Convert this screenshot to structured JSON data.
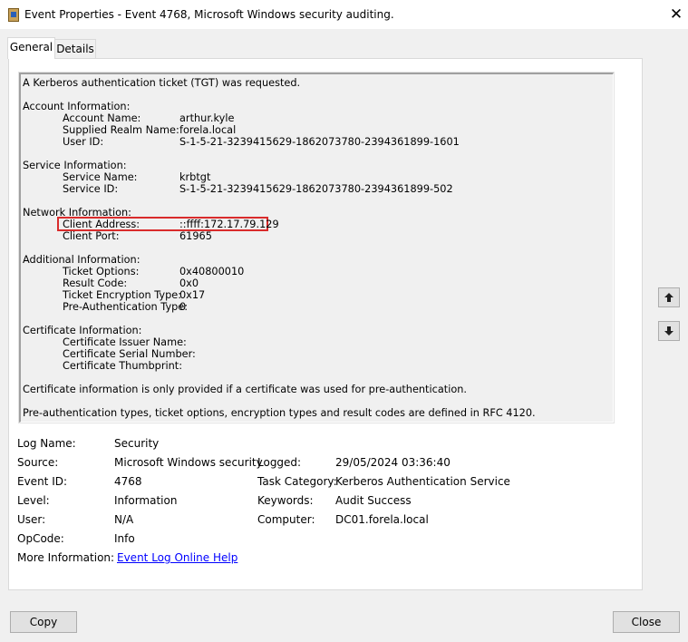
{
  "window": {
    "title": "Event Properties - Event 4768, Microsoft Windows security auditing.",
    "icon": "event-viewer-icon",
    "close_glyph": "✕"
  },
  "tabs": [
    {
      "label": "General",
      "active": true
    },
    {
      "label": "Details",
      "active": false
    }
  ],
  "description": {
    "summary": "A Kerberos authentication ticket (TGT) was requested.",
    "account_header": "Account Information:",
    "account": [
      {
        "label": "Account Name:",
        "value": "arthur.kyle"
      },
      {
        "label": "Supplied Realm Name:",
        "value": "forela.local"
      },
      {
        "label": "User ID:",
        "value": "S-1-5-21-3239415629-1862073780-2394361899-1601"
      }
    ],
    "service_header": "Service Information:",
    "service": [
      {
        "label": "Service Name:",
        "value": "krbtgt"
      },
      {
        "label": "Service ID:",
        "value": "S-1-5-21-3239415629-1862073780-2394361899-502"
      }
    ],
    "network_header": "Network Information:",
    "network": [
      {
        "label": "Client Address:",
        "value": "::ffff:172.17.79.129"
      },
      {
        "label": "Client Port:",
        "value": "61965"
      }
    ],
    "additional_header": "Additional Information:",
    "additional": [
      {
        "label": "Ticket Options:",
        "value": "0x40800010"
      },
      {
        "label": "Result Code:",
        "value": "0x0"
      },
      {
        "label": "Ticket Encryption Type:",
        "value": "0x17"
      },
      {
        "label": "Pre-Authentication Type:",
        "value": "0"
      }
    ],
    "certificate_header": "Certificate Information:",
    "certificate": [
      {
        "label": "Certificate Issuer Name:",
        "value": ""
      },
      {
        "label": "Certificate Serial Number:",
        "value": ""
      },
      {
        "label": "Certificate Thumbprint:",
        "value": ""
      }
    ],
    "note1": "Certificate information is only provided if a certificate was used for pre-authentication.",
    "note2": "Pre-authentication types, ticket options, encryption types and result codes are defined in RFC 4120."
  },
  "details": {
    "log_name_label": "Log Name:",
    "log_name": "Security",
    "source_label": "Source:",
    "source": "Microsoft Windows security",
    "logged_label": "Logged:",
    "logged": "29/05/2024 03:36:40",
    "event_id_label": "Event ID:",
    "event_id": "4768",
    "task_category_label": "Task Category:",
    "task_category": "Kerberos Authentication Service",
    "level_label": "Level:",
    "level": "Information",
    "keywords_label": "Keywords:",
    "keywords": "Audit Success",
    "user_label": "User:",
    "user": "N/A",
    "computer_label": "Computer:",
    "computer": "DC01.forela.local",
    "opcode_label": "OpCode:",
    "opcode": "Info",
    "more_info_label": "More Information:",
    "more_info_link": "Event Log Online Help"
  },
  "nav": {
    "up_icon": "arrow-up-icon",
    "down_icon": "arrow-down-icon"
  },
  "buttons": {
    "copy": "Copy",
    "close": "Close"
  },
  "colors": {
    "highlight_border": "#d92b2b",
    "link": "#0000ff"
  }
}
